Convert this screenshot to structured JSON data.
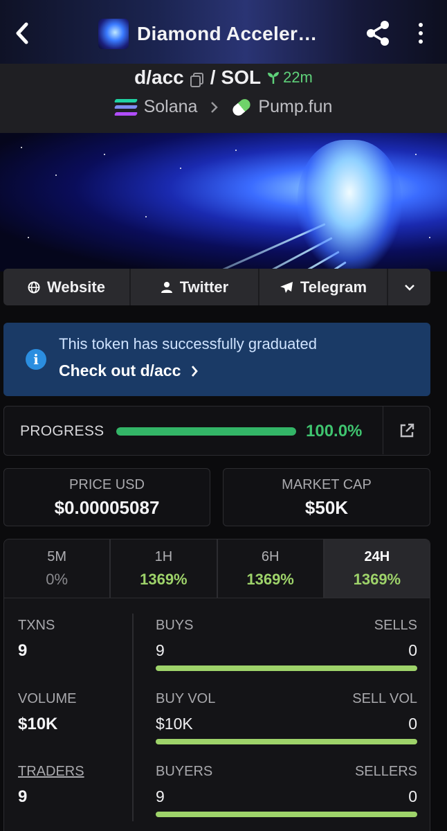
{
  "header": {
    "title": "Diamond Acceler…",
    "back_icon": "chevron-left-icon",
    "share_icon": "share-icon",
    "more_icon": "more-vertical-icon"
  },
  "pair": {
    "base": "d/acc",
    "separator": "/",
    "quote": "SOL",
    "age": "22m"
  },
  "chain": {
    "network": "Solana",
    "dex": "Pump.fun"
  },
  "links": {
    "website": "Website",
    "twitter": "Twitter",
    "telegram": "Telegram"
  },
  "notice": {
    "message": "This token has successfully graduated",
    "cta": "Check out d/acc"
  },
  "progress": {
    "label": "PROGRESS",
    "value_text": "100.0%",
    "fraction": 1.0
  },
  "stats": {
    "price_label": "PRICE USD",
    "price_value": "$0.00005087",
    "mcap_label": "MARKET CAP",
    "mcap_value": "$50K"
  },
  "timeframes": [
    {
      "name": "5M",
      "pct": "0%"
    },
    {
      "name": "1H",
      "pct": "1369%"
    },
    {
      "name": "6H",
      "pct": "1369%"
    },
    {
      "name": "24H",
      "pct": "1369%"
    }
  ],
  "active_timeframe": "24H",
  "txns": {
    "label": "TXNS",
    "value": "9",
    "buys_label": "BUYS",
    "buys": "9",
    "sells_label": "SELLS",
    "sells": "0",
    "buy_fraction": 1.0
  },
  "volume": {
    "label": "VOLUME",
    "value": "$10K",
    "buy_label": "BUY VOL",
    "buy": "$10K",
    "sell_label": "SELL VOL",
    "sell": "0",
    "buy_fraction": 1.0
  },
  "traders": {
    "label": "TRADERS",
    "value": "9",
    "buyers_label": "BUYERS",
    "buyers": "9",
    "sellers_label": "SELLERS",
    "sellers": "0",
    "buy_fraction": 1.0
  },
  "colors": {
    "green": "#3fc46f",
    "lime": "#9ed36a",
    "notice_bg": "#1a3a66"
  }
}
